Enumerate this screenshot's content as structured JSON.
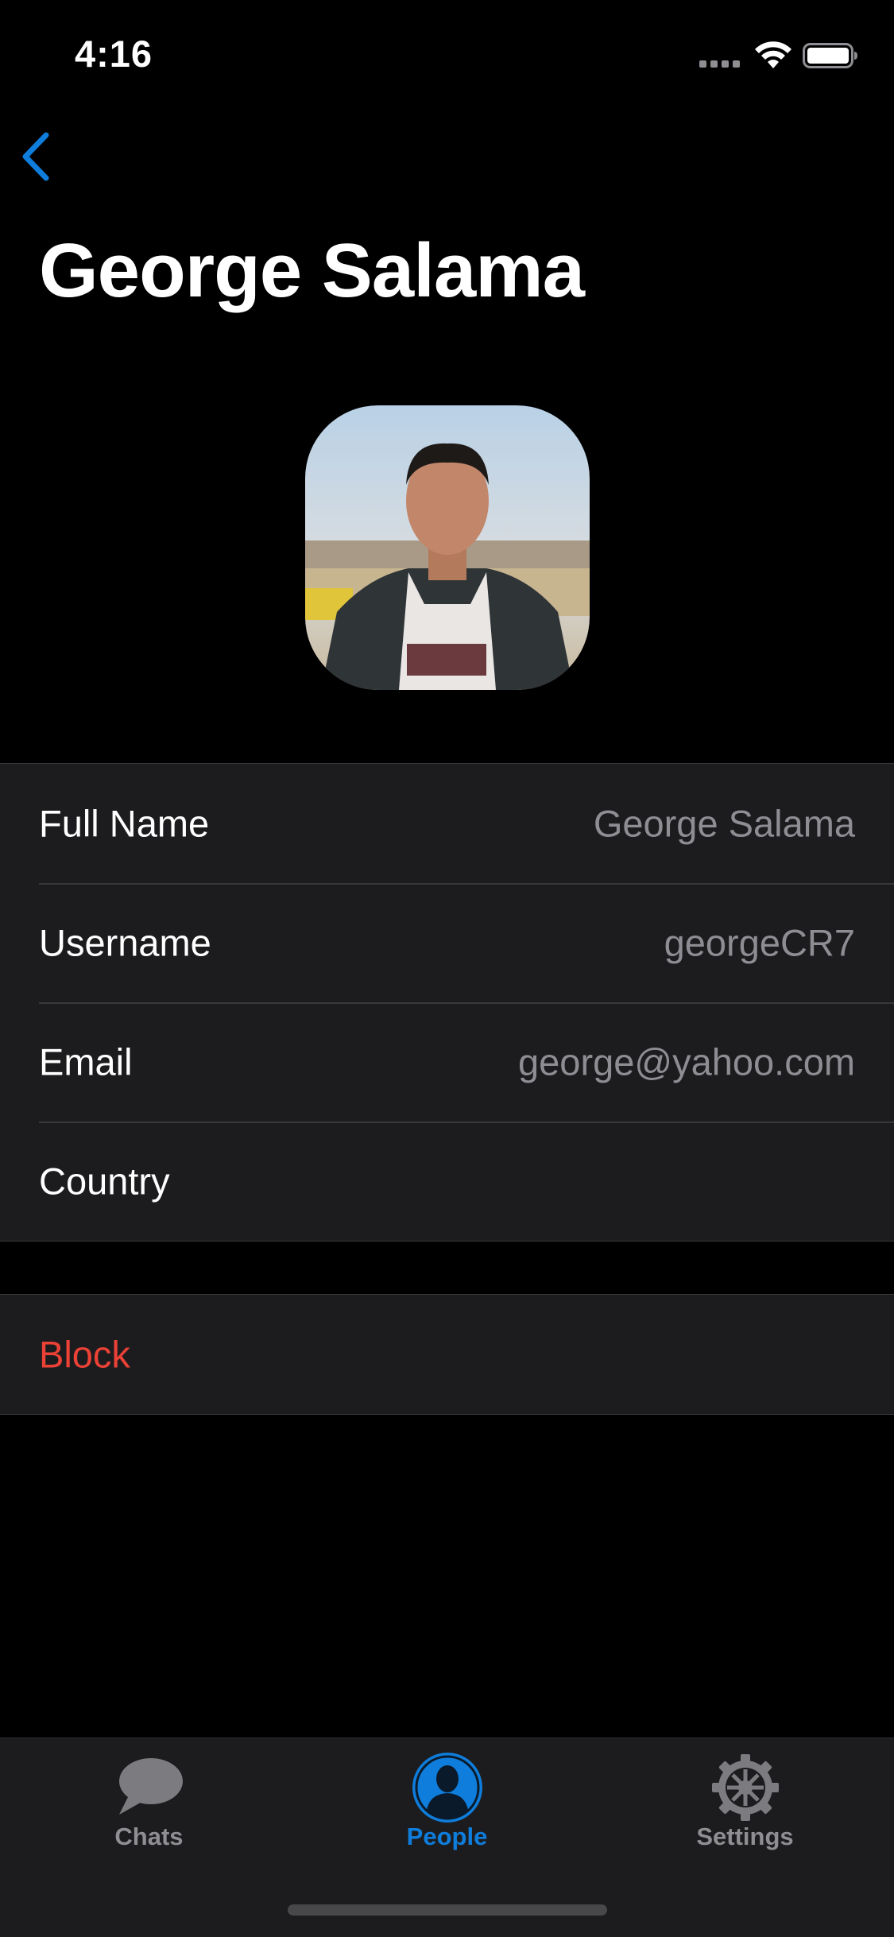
{
  "status_bar": {
    "time": "4:16"
  },
  "nav": {
    "title": "George Salama"
  },
  "profile": {
    "avatar_desc": "profile-photo"
  },
  "info_rows": [
    {
      "label": "Full Name",
      "value": "George Salama"
    },
    {
      "label": "Username",
      "value": "georgeCR7"
    },
    {
      "label": "Email",
      "value": "george@yahoo.com"
    },
    {
      "label": "Country",
      "value": ""
    }
  ],
  "actions": {
    "block_label": "Block"
  },
  "tabs": [
    {
      "label": "Chats",
      "icon": "chat-bubble-icon",
      "active": false
    },
    {
      "label": "People",
      "icon": "person-icon",
      "active": true
    },
    {
      "label": "Settings",
      "icon": "gear-icon",
      "active": false
    }
  ],
  "colors": {
    "accent": "#0f7ddb",
    "danger": "#eb4136",
    "background": "#000000",
    "cell": "#1c1c1e"
  }
}
